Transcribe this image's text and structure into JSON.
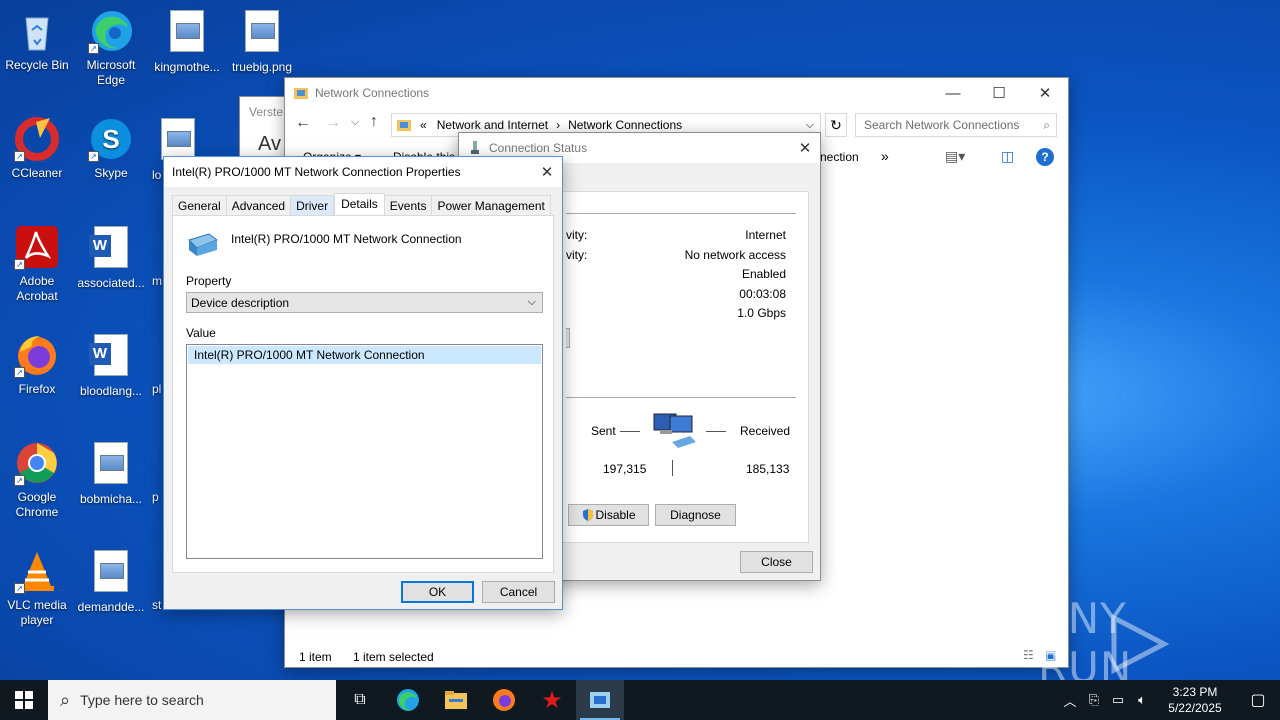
{
  "desktop": {
    "icons": [
      {
        "label": "Recycle Bin"
      },
      {
        "label": "Microsoft Edge"
      },
      {
        "label": "kingmothe..."
      },
      {
        "label": "truebig.png"
      },
      {
        "label": "CCleaner"
      },
      {
        "label": "Skype"
      },
      {
        "label": "Adobe Acrobat"
      },
      {
        "label": "associated..."
      },
      {
        "label": "Firefox"
      },
      {
        "label": "bloodlang..."
      },
      {
        "label": "Google Chrome"
      },
      {
        "label": "bobmicha..."
      },
      {
        "label": "VLC media player"
      },
      {
        "label": "demandde..."
      }
    ],
    "partial_labels": [
      "lo",
      "m",
      "pl",
      "p",
      "st"
    ],
    "bg_window_fragments": {
      "title": "Verste",
      "heading": "Av"
    }
  },
  "explorer": {
    "title": "Network Connections",
    "breadcrumb": [
      "«",
      "Network and Internet",
      "Network Connections"
    ],
    "search_placeholder": "Search Network Connections",
    "toolbar": {
      "organize": "Organize ▾",
      "disable": "Disable this",
      "connection": "nection",
      "more": "»"
    },
    "status": {
      "items": "1 item",
      "selected": "1 item selected"
    }
  },
  "status_dialog": {
    "title": "Connection Status",
    "rows": [
      {
        "label": "vity:",
        "value": "Internet"
      },
      {
        "label": "vity:",
        "value": "No network access"
      },
      {
        "label": "",
        "value": "Enabled"
      },
      {
        "label": "",
        "value": "00:03:08"
      },
      {
        "label": "",
        "value": "1.0 Gbps"
      }
    ],
    "activity": {
      "sent_label": "Sent",
      "received_label": "Received",
      "sent_value": "197,315",
      "received_value": "185,133"
    },
    "buttons": {
      "disable": "Disable",
      "diagnose": "Diagnose",
      "close": "Close"
    }
  },
  "props_dialog": {
    "title": "Intel(R) PRO/1000 MT Network Connection Properties",
    "tabs": [
      "General",
      "Advanced",
      "Driver",
      "Details",
      "Events",
      "Power Management"
    ],
    "active_tab": "Details",
    "device_name": "Intel(R) PRO/1000 MT Network Connection",
    "property_label": "Property",
    "property_value": "Device description",
    "value_label": "Value",
    "value_items": [
      "Intel(R) PRO/1000 MT Network Connection"
    ],
    "ok": "OK",
    "cancel": "Cancel"
  },
  "taskbar": {
    "search_placeholder": "Type here to search",
    "time": "3:23 PM",
    "date": "5/22/2025"
  },
  "watermark": "ANY RUN",
  "colors": {
    "accent": "#0078d7",
    "selection": "#cce8ff",
    "taskbar": "#101820"
  }
}
